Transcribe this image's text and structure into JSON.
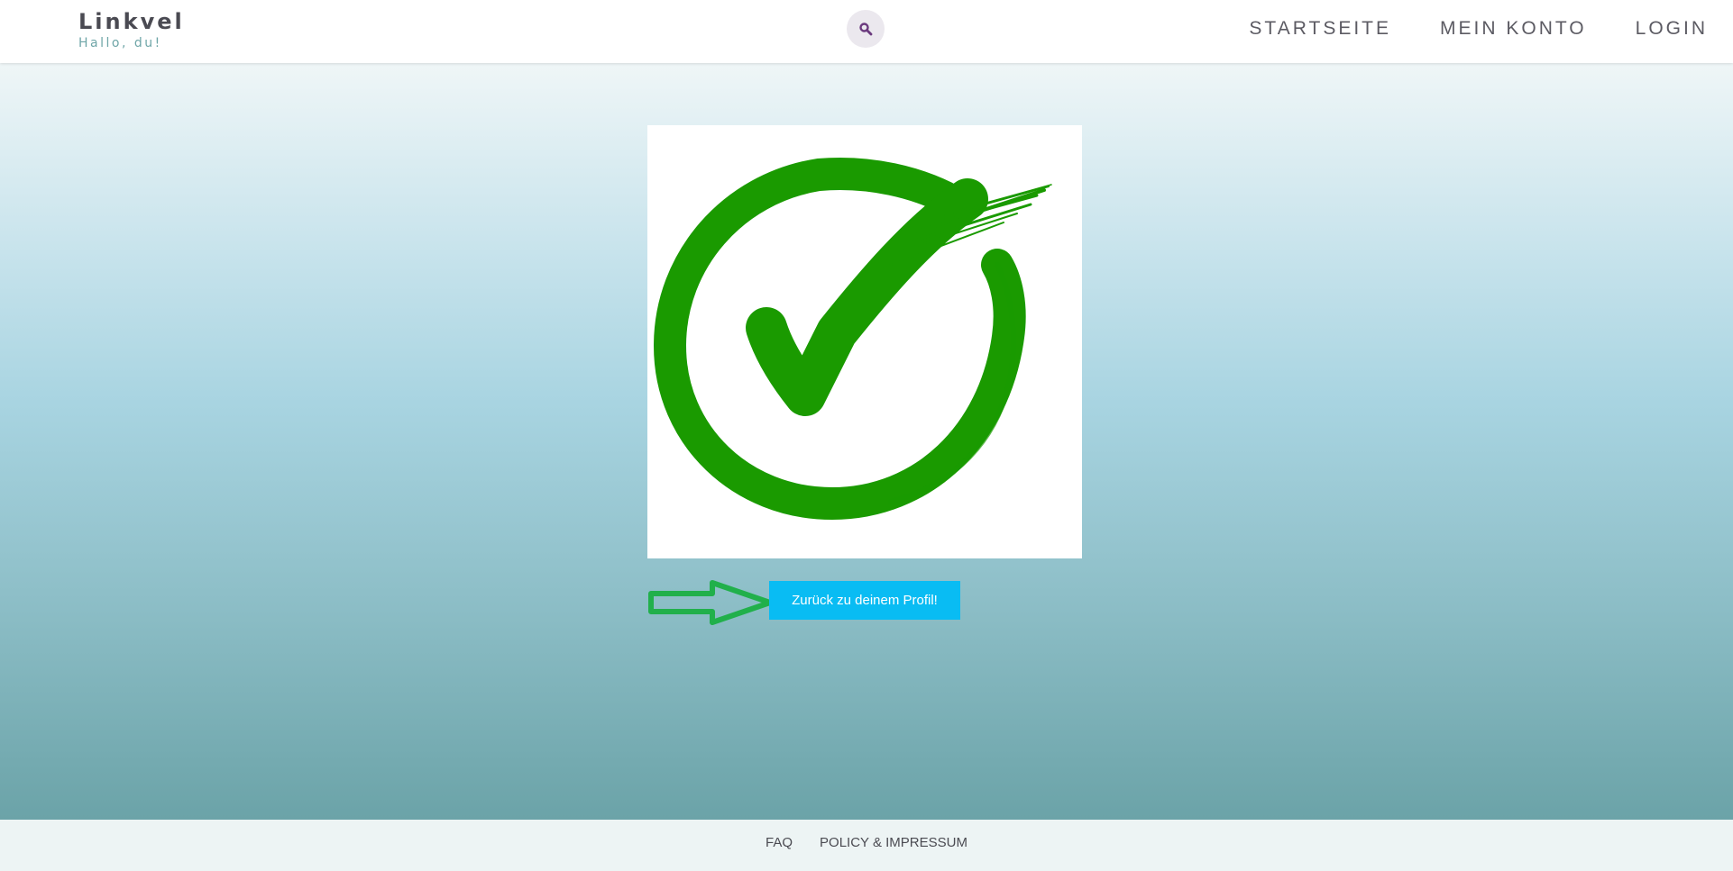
{
  "header": {
    "logo_title": "Linkvel",
    "logo_subtitle": "Hallo, du!",
    "search_icon": "search-icon",
    "nav": [
      {
        "label": "STARTSEITE"
      },
      {
        "label": "MEIN KONTO"
      },
      {
        "label": "LOGIN"
      }
    ]
  },
  "main": {
    "success_icon": "checkmark-circle-icon",
    "success_color": "#1a9a00",
    "arrow_icon": "arrow-right-outline-icon",
    "arrow_color": "#21b04b",
    "button_label": "Zurück zu deinem Profil!",
    "button_color": "#09bcf3"
  },
  "footer": {
    "links": [
      {
        "label": "FAQ"
      },
      {
        "label": "POLICY & IMPRESSUM"
      }
    ]
  }
}
